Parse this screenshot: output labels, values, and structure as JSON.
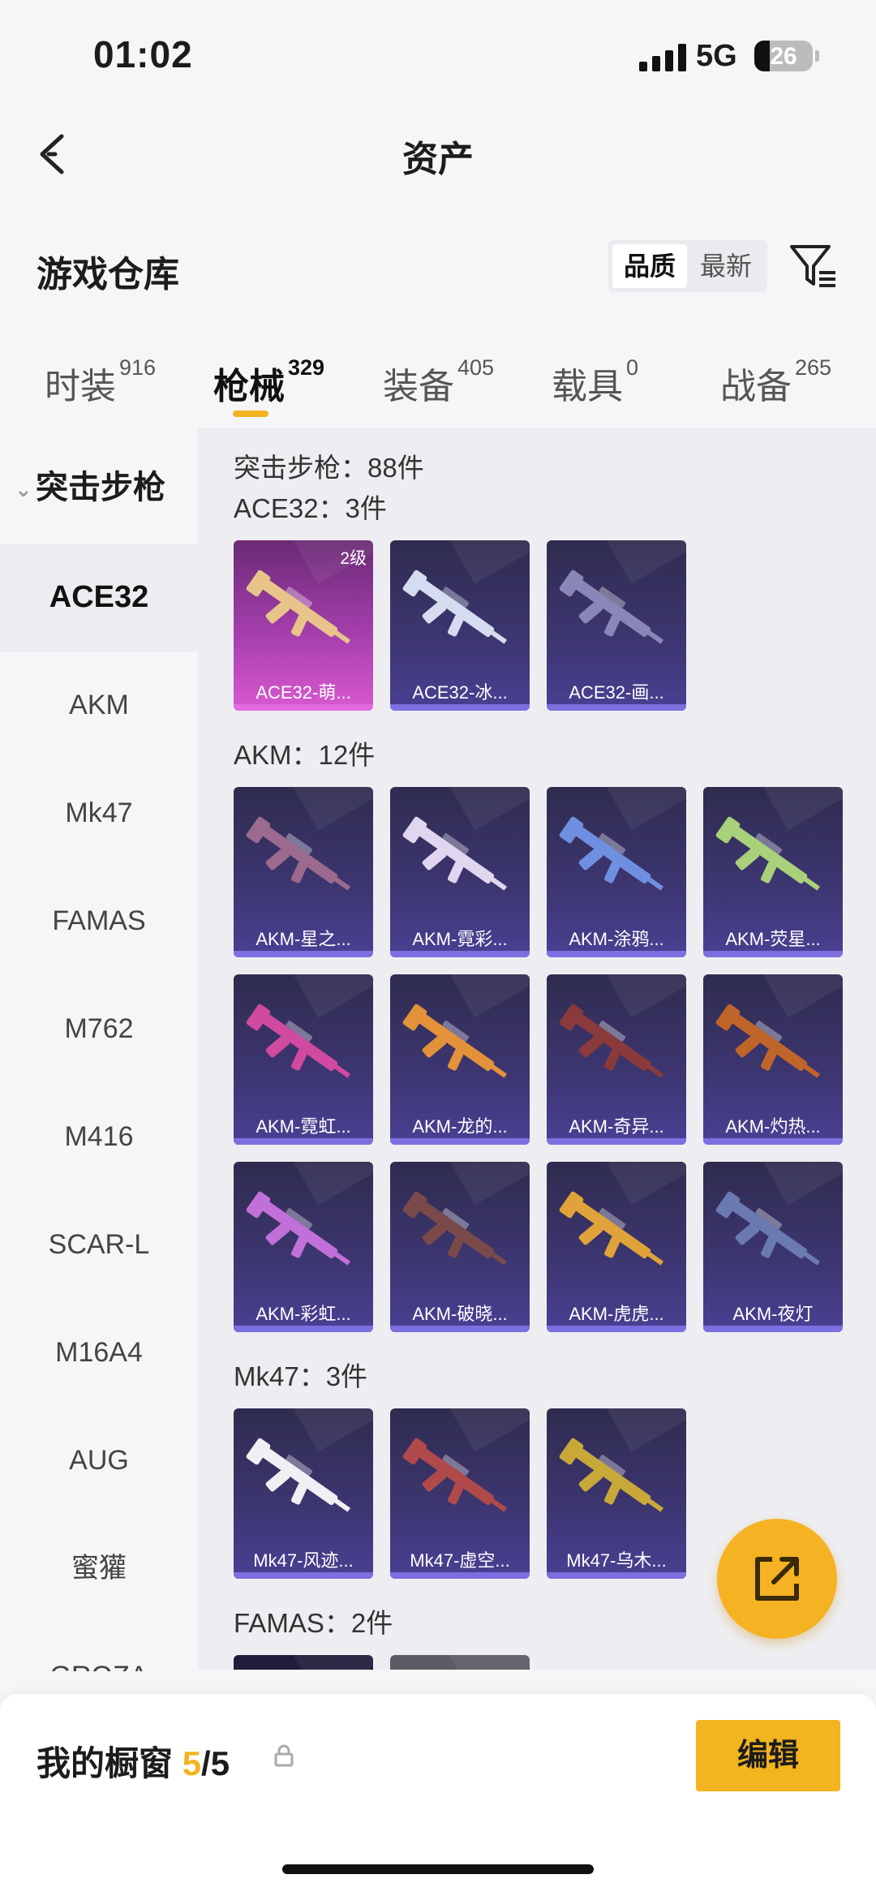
{
  "status_bar": {
    "time": "01:02",
    "network": "5G",
    "battery": "26",
    "battery_fraction": 0.26
  },
  "header": {
    "title": "资产"
  },
  "warehouse": {
    "title": "游戏仓库",
    "sort_options": [
      {
        "label": "品质",
        "active": true
      },
      {
        "label": "最新",
        "active": false
      }
    ]
  },
  "tabs": [
    {
      "label": "时装",
      "count": "916",
      "active": false
    },
    {
      "label": "枪械",
      "count": "329",
      "active": true
    },
    {
      "label": "装备",
      "count": "405",
      "active": false
    },
    {
      "label": "载具",
      "count": "0",
      "active": false
    },
    {
      "label": "战备",
      "count": "265",
      "active": false
    }
  ],
  "sidebar": {
    "group": "突击步枪",
    "items": [
      "ACE32",
      "AKM",
      "Mk47",
      "FAMAS",
      "M762",
      "M416",
      "SCAR-L",
      "M16A4",
      "AUG",
      "蜜獾",
      "GROZA"
    ],
    "active_index": 0
  },
  "content": {
    "category_total": "突击步枪：88件",
    "groups": [
      {
        "title": "ACE32：3件",
        "items": [
          {
            "label": "ACE32-萌...",
            "level": "2级",
            "style": "pink",
            "color": "#e8c48a"
          },
          {
            "label": "ACE32-冰...",
            "style": "normal",
            "color": "#d6dcf0"
          },
          {
            "label": "ACE32-画...",
            "style": "normal",
            "color": "#8a86b8"
          }
        ]
      },
      {
        "title": "AKM：12件",
        "items": [
          {
            "label": "AKM-星之...",
            "style": "normal",
            "color": "#9c6a8e"
          },
          {
            "label": "AKM-霓彩...",
            "style": "normal",
            "color": "#e0d6f0"
          },
          {
            "label": "AKM-涂鸦...",
            "style": "normal",
            "color": "#6f8fe0"
          },
          {
            "label": "AKM-荧星...",
            "style": "normal",
            "color": "#a9d07a"
          },
          {
            "label": "AKM-霓虹...",
            "style": "normal",
            "color": "#d04aa0"
          },
          {
            "label": "AKM-龙的...",
            "style": "normal",
            "color": "#e3923a"
          },
          {
            "label": "AKM-奇异...",
            "style": "normal",
            "color": "#8a3a3a"
          },
          {
            "label": "AKM-灼热...",
            "style": "normal",
            "color": "#c0652a"
          },
          {
            "label": "AKM-彩虹...",
            "style": "normal",
            "color": "#c070d8"
          },
          {
            "label": "AKM-破晓...",
            "style": "normal",
            "color": "#7a4a4a"
          },
          {
            "label": "AKM-虎虎...",
            "style": "normal",
            "color": "#e0a23a"
          },
          {
            "label": "AKM-夜灯",
            "style": "normal",
            "color": "#6a7ab0"
          }
        ]
      },
      {
        "title": "Mk47：3件",
        "items": [
          {
            "label": "Mk47-风迹...",
            "style": "normal",
            "color": "#f0f0f4"
          },
          {
            "label": "Mk47-虚空...",
            "style": "normal",
            "color": "#b04a4a"
          },
          {
            "label": "Mk47-乌木...",
            "style": "normal",
            "color": "#c9a83a"
          }
        ]
      },
      {
        "title": "FAMAS：2件",
        "items": [
          {
            "label": "",
            "style": "dark",
            "color": "#555"
          },
          {
            "label": "",
            "style": "gray",
            "color": "#777"
          }
        ]
      }
    ]
  },
  "showcase": {
    "label": "我的橱窗",
    "current": "5",
    "total": "/5"
  },
  "edit_button": {
    "label": "编辑"
  },
  "colors": {
    "accent": "#f2b41f",
    "card_bg": "#3d3672",
    "card_bar": "#7c6fe0"
  }
}
